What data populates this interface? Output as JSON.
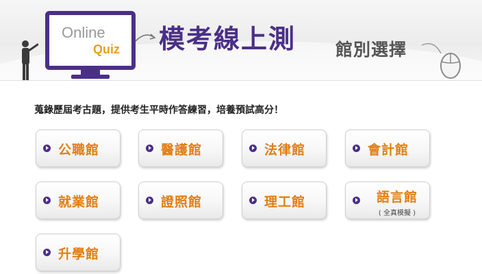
{
  "header": {
    "logo_online": "Online",
    "logo_quiz": "Quiz",
    "title_main": "模考線上測",
    "title_sub": "館別選擇"
  },
  "intro_text": "蒐錄歷屆考古題，提供考生平時作答練習，培養預試高分！",
  "categories": [
    {
      "label": "公職館"
    },
    {
      "label": "醫護館"
    },
    {
      "label": "法律館"
    },
    {
      "label": "會計館"
    },
    {
      "label": "就業館"
    },
    {
      "label": "證照館"
    },
    {
      "label": "理工館"
    },
    {
      "label": "語言館",
      "note": "( 全真模擬 )"
    },
    {
      "label": "升學館"
    }
  ],
  "colors": {
    "brand_purple": "#4b2f87",
    "label_orange": "#e27e12",
    "quiz_orange": "#e8a019"
  }
}
